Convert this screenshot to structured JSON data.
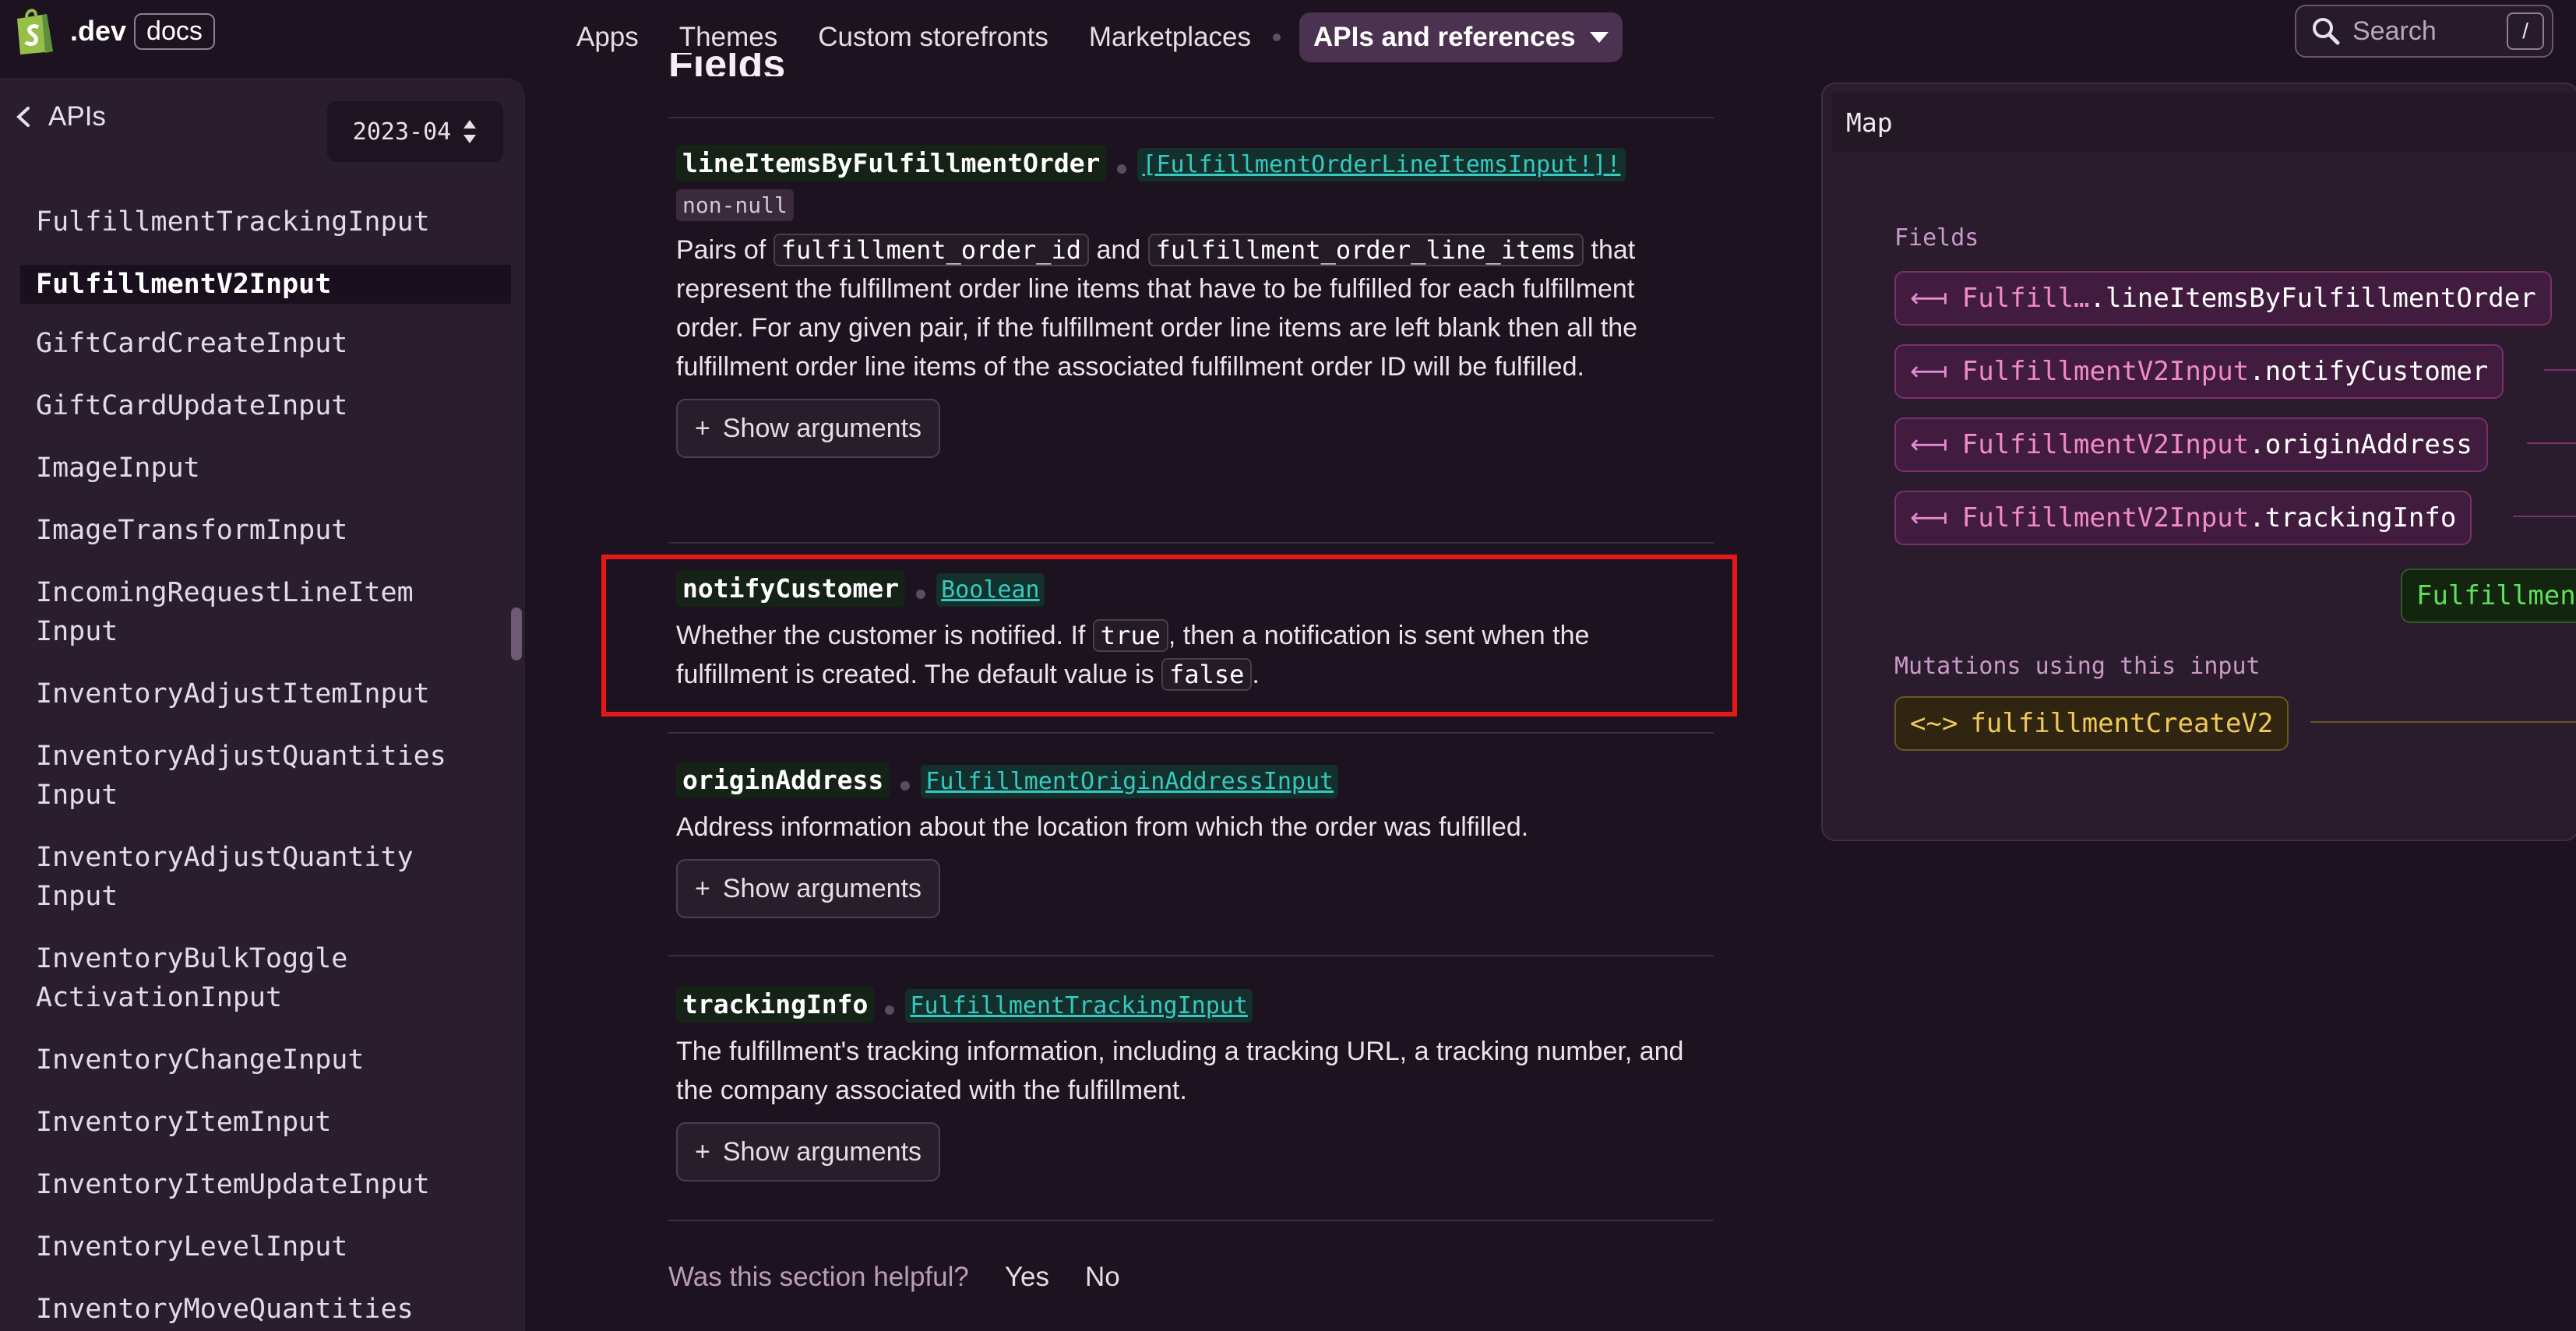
{
  "brand": {
    "dev": ".dev",
    "docs": "docs",
    "accent": "#95bf47"
  },
  "nav": {
    "links": [
      "Apps",
      "Themes",
      "Custom storefronts",
      "Marketplaces"
    ],
    "active": "APIs and references"
  },
  "search": {
    "placeholder": "Search",
    "shortcut": "/"
  },
  "sidebar": {
    "back_label": "APIs",
    "version": "2023-04",
    "items": [
      "FulfillmentTrackingInput",
      "FulfillmentV2Input",
      "GiftCardCreateInput",
      "GiftCardUpdateInput",
      "ImageInput",
      "ImageTransformInput",
      "IncomingRequestLineItem\nInput",
      "InventoryAdjustItemInput",
      "InventoryAdjustQuantities\nInput",
      "InventoryAdjustQuantity\nInput",
      "InventoryBulkToggle\nActivationInput",
      "InventoryChangeInput",
      "InventoryItemInput",
      "InventoryItemUpdateInput",
      "InventoryLevelInput",
      "InventoryMoveQuantities"
    ],
    "active_index": 1
  },
  "main": {
    "section_title": "Fields",
    "fields": [
      {
        "name": "lineItemsByFulfillmentOrder",
        "type": "[FulfillmentOrderLineItemsInput!]!",
        "badge": "non-null",
        "desc_parts": {
          "t1": "Pairs of ",
          "c1": "fulfillment_order_id",
          "t2": " and ",
          "c2": "fulfillment_order_line_items",
          "t3": " that represent the fulfillment order line items that have to be fulfilled for each fulfillment order. For any given pair, if the fulfillment order line items are left blank then all the fulfillment order line items of the associated fulfillment order ID will be fulfilled."
        },
        "button": "Show arguments"
      },
      {
        "name": "notifyCustomer",
        "type": "Boolean",
        "desc_parts": {
          "t1": "Whether the customer is notified. If ",
          "c1": "true",
          "t2": ", then a notification is sent when the fulfillment is created. The default value is ",
          "c2": "false",
          "t3": "."
        }
      },
      {
        "name": "originAddress",
        "type": "FulfillmentOriginAddressInput",
        "desc": "Address information about the location from which the order was fulfilled.",
        "button": "Show arguments"
      },
      {
        "name": "trackingInfo",
        "type": "FulfillmentTrackingInput",
        "desc": "The fulfillment's tracking information, including a tracking URL, a tracking number, and the company associated with the fulfillment.",
        "button": "Show arguments"
      }
    ],
    "feedback": {
      "question": "Was this section helpful?",
      "yes": "Yes",
      "no": "No"
    }
  },
  "map": {
    "title": "Map",
    "fields_label": "Fields",
    "pills": [
      {
        "type": "Fulfill…",
        "field": ".lineItemsByFulfillmentOrder"
      },
      {
        "type": "FulfillmentV2Input",
        "field": ".notifyCustomer"
      },
      {
        "type": "FulfillmentV2Input",
        "field": ".originAddress"
      },
      {
        "type": "FulfillmentV2Input",
        "field": ".trackingInfo"
      }
    ],
    "target": "Fulfillmen",
    "mutations_label": "Mutations using this input",
    "mutation": "fulfillmentCreateV2"
  },
  "colors": {
    "highlight": "#e51717",
    "type_link": "#35c9c0",
    "map_accent": "#f08ac8"
  }
}
